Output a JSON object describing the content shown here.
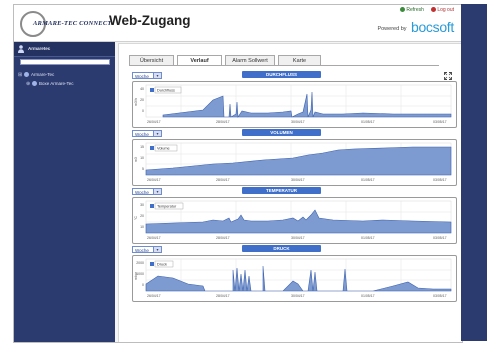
{
  "header": {
    "logo_text": "ARMARE-TEC CONNECT",
    "title": "Web-Zugang",
    "links": [
      {
        "label": "Refresh"
      },
      {
        "label": "Log out"
      }
    ],
    "powered_by": "Powered by",
    "brand": "bocsoft"
  },
  "sidebar": {
    "user_label": "Armaretec",
    "tree": [
      {
        "label": "Armare-Tec",
        "toggle": "⊞"
      },
      {
        "label": "Boxe Armare-Tec",
        "toggle": "⊕"
      }
    ]
  },
  "tabs": [
    {
      "label": "Übersicht",
      "active": false
    },
    {
      "label": "Verlauf",
      "active": true
    },
    {
      "label": "Alarm Sollwert",
      "active": false
    },
    {
      "label": "Karte",
      "active": false
    }
  ],
  "colors": {
    "accent": "#3f6fc8",
    "sidebar": "#2b3b6f",
    "series_fill": "#7d9bd0",
    "series_line": "#3d62b0"
  },
  "charts": [
    {
      "range": "Woche",
      "title": "DURCHFLUSS",
      "legend": "Durchfluss",
      "x_labels": [
        "26/04/17",
        "28/04/17",
        "30/04/17",
        "01/05/17",
        "03/05/17"
      ],
      "y_labels": [
        "40",
        "20",
        "0"
      ],
      "ylabel": "m3/h"
    },
    {
      "range": "Woche",
      "title": "VOLUMEN",
      "legend": "Volume",
      "x_labels": [
        "26/04/17",
        "28/04/17",
        "30/04/17",
        "01/05/17",
        "03/05/17"
      ],
      "y_labels": [
        "15",
        "10",
        "5"
      ],
      "ylabel": "m3"
    },
    {
      "range": "Woche",
      "title": "TEMPERATUR",
      "legend": "Temperatur",
      "x_labels": [
        "26/04/17",
        "28/04/17",
        "30/04/17",
        "01/05/17",
        "03/05/17"
      ],
      "y_labels": [
        "30",
        "20",
        "10"
      ],
      "ylabel": "°C"
    },
    {
      "range": "Woche",
      "title": "DRUCK",
      "legend": "Druck",
      "x_labels": [
        "26/04/17",
        "28/04/17",
        "30/04/17",
        "01/05/17",
        "03/05/17"
      ],
      "y_labels": [
        "2000",
        "1000",
        "0"
      ],
      "ylabel": "mbar"
    }
  ]
}
